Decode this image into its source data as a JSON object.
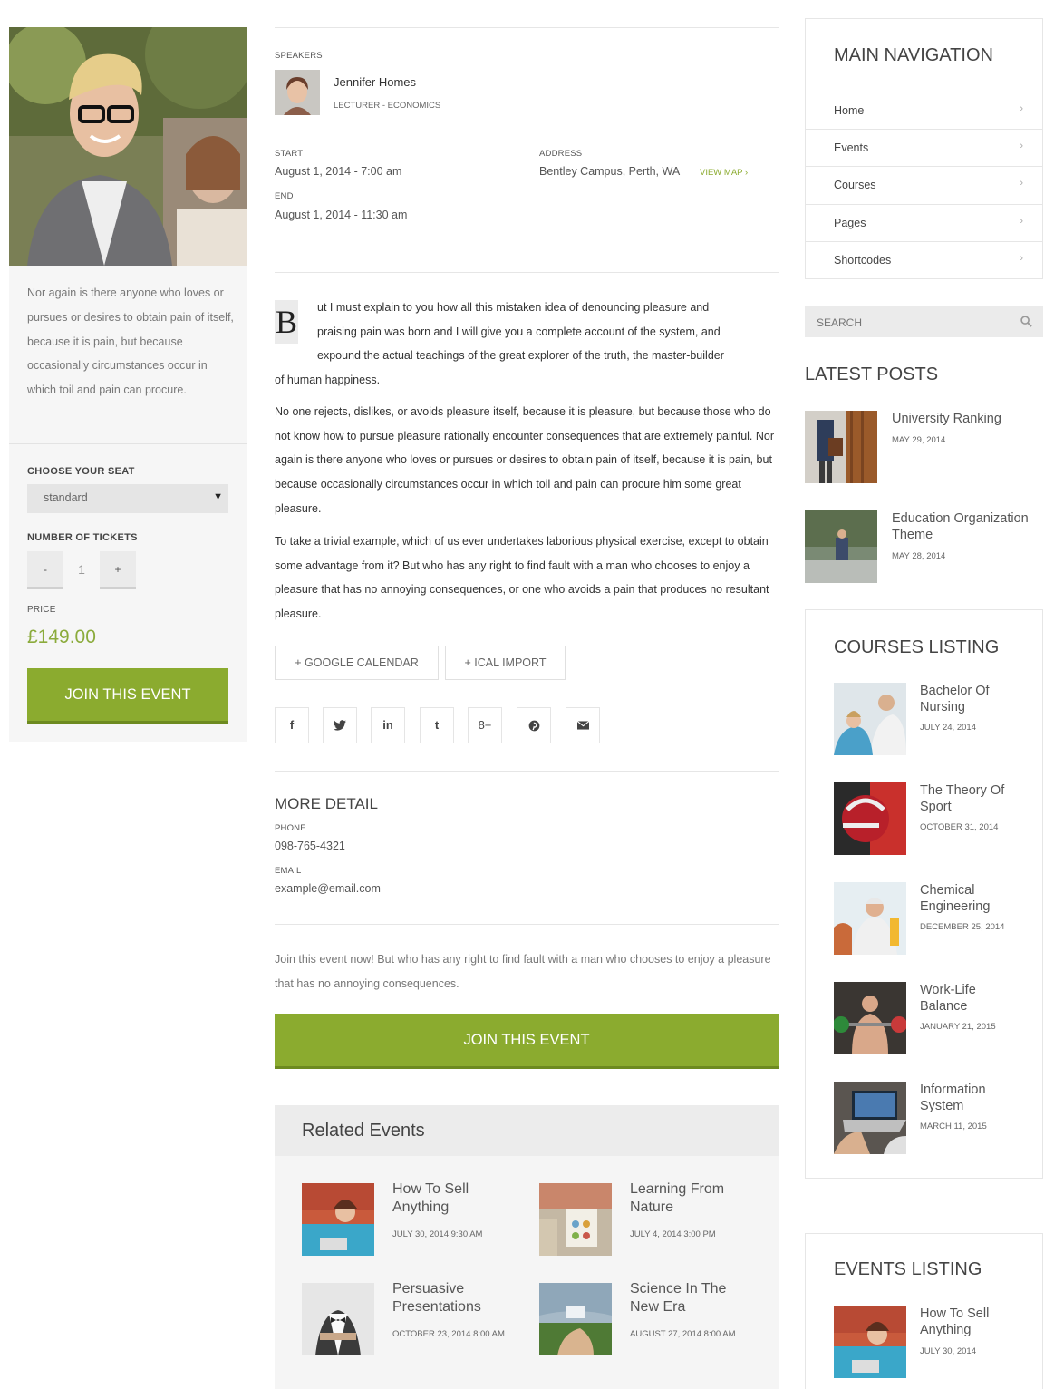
{
  "left": {
    "description": "Nor again is there anyone who loves or pursues or desires to obtain pain of itself, because it is pain, but because occasionally circumstances occur in which toil and pain can procure.",
    "choose_seat_label": "CHOOSE YOUR SEAT",
    "seat_value": "standard",
    "tickets_label": "NUMBER OF TICKETS",
    "minus": "-",
    "qty": "1",
    "plus": "+",
    "price_label": "PRICE",
    "price": "£149.00",
    "join_label": "JOIN THIS EVENT"
  },
  "main": {
    "speakers_label": "SPEAKERS",
    "speaker_name": "Jennifer Homes",
    "speaker_role": "LECTURER - ECONOMICS",
    "start_label": "START",
    "start_value": "August 1, 2014 - 7:00 am",
    "end_label": "END",
    "end_value": "August 1, 2014 - 11:30 am",
    "address_label": "ADDRESS",
    "address_value": "Bentley Campus, Perth, WA",
    "view_map": "VIEW MAP ›",
    "dropcap": "B",
    "para1_lines": [
      "ut I must explain to you how all this mistaken idea of denouncing pleasure and",
      "praising pain was born and I will give you a complete account of the system, and",
      "expound the actual teachings of the great explorer of the truth, the master-builder"
    ],
    "para1_last": "of human happiness.",
    "para2": "No one rejects, dislikes, or avoids pleasure itself, because it is pleasure, but because those who do not know how to pursue pleasure rationally encounter consequences that are extremely painful. Nor again is there anyone who loves or pursues or desires to obtain pain of itself, because it is pain, but because occasionally circumstances occur in which toil and pain can procure him some great pleasure.",
    "para3": "To take a trivial example, which of us ever undertakes laborious physical exercise, except to obtain some advantage from it? But who has any right to find fault with a man who chooses to enjoy a pleasure that has no annoying consequences, or one who avoids a pain that produces no resultant pleasure.",
    "gcal": "+ GOOGLE CALENDAR",
    "ical": "+ ICAL IMPORT",
    "social": [
      "f",
      "🐦",
      "in",
      "t",
      "8+",
      "℗",
      "✉"
    ],
    "more_detail": "MORE DETAIL",
    "phone_label": "PHONE",
    "phone": "098-765-4321",
    "email_label": "EMAIL",
    "email": "example@email.com",
    "join_text": "Join this event now! But who has any right to find fault with a man who chooses to enjoy a pleasure that has no annoying consequences.",
    "join_label": "JOIN THIS EVENT",
    "related_title": "Related Events",
    "related": [
      {
        "title": "How To Sell Anything",
        "date": "JULY 30, 2014 9:30 AM"
      },
      {
        "title": "Learning From Nature",
        "date": "JULY 4, 2014 3:00 PM"
      },
      {
        "title": "Persuasive Presentations",
        "date": "OCTOBER 23, 2014 8:00 AM"
      },
      {
        "title": "Science In The New Era",
        "date": "AUGUST 27, 2014 8:00 AM"
      }
    ]
  },
  "sidebar": {
    "nav_title": "MAIN NAVIGATION",
    "nav": [
      "Home",
      "Events",
      "Courses",
      "Pages",
      "Shortcodes"
    ],
    "chevron": "›",
    "search_placeholder": "SEARCH",
    "latest_title": "LATEST POSTS",
    "posts": [
      {
        "title": "University Ranking",
        "date": "MAY 29, 2014"
      },
      {
        "title": "Education Organization Theme",
        "date": "MAY 28, 2014"
      }
    ],
    "courses_title": "COURSES LISTING",
    "courses": [
      {
        "title": "Bachelor Of Nursing",
        "date": "JULY 24, 2014"
      },
      {
        "title": "The Theory Of Sport",
        "date": "OCTOBER 31, 2014"
      },
      {
        "title": "Chemical Engineering",
        "date": "DECEMBER 25, 2014"
      },
      {
        "title": "Work-Life Balance",
        "date": "JANUARY 21, 2015"
      },
      {
        "title": "Information System",
        "date": "MARCH 11, 2015"
      }
    ],
    "events_title": "EVENTS LISTING",
    "events": [
      {
        "title": "How To Sell Anything",
        "date": "JULY 30, 2014"
      }
    ]
  },
  "colors": {
    "accent": "#8bab2f",
    "price": "#8bab3c"
  }
}
